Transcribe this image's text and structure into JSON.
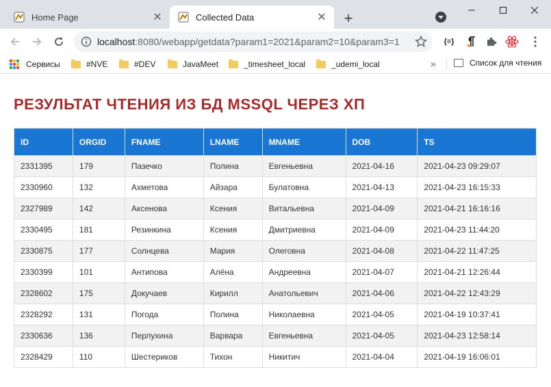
{
  "browser": {
    "tabs": [
      {
        "title": "Home Page",
        "active": false
      },
      {
        "title": "Collected Data",
        "active": true
      }
    ],
    "address": {
      "host": "localhost",
      "rest": ":8080/webapp/getdata?param1=2021&param2=10&param3=1"
    },
    "extensions": [
      "json-viewer-icon",
      "pilcrow-icon",
      "puzzle-icon",
      "react-icon"
    ],
    "bookmarks": {
      "apps_label": "Сервисы",
      "folders": [
        "#NVE",
        "#DEV",
        "JavaMeet",
        "_timesheet_local",
        "_udemi_local"
      ],
      "more": "»",
      "reading_list": "Список для чтения"
    }
  },
  "page": {
    "heading": "РЕЗУЛЬТАТ ЧТЕНИЯ ИЗ БД MSSQL ЧЕРЕЗ ХП",
    "columns": [
      "ID",
      "ORGID",
      "FNAME",
      "LNAME",
      "MNAME",
      "DOB",
      "TS"
    ],
    "rows": [
      [
        "2331395",
        "179",
        "Пазечко",
        "Полина",
        "Евгеньевна",
        "2021-04-16",
        "2021-04-23 09:29:07"
      ],
      [
        "2330960",
        "132",
        "Ахметова",
        "Айзара",
        "Булатовна",
        "2021-04-13",
        "2021-04-23 16:15:33"
      ],
      [
        "2327989",
        "142",
        "Аксенова",
        "Ксения",
        "Витальевна",
        "2021-04-09",
        "2021-04-21 16:16:16"
      ],
      [
        "2330495",
        "181",
        "Резинкина",
        "Ксения",
        "Дмитриевна",
        "2021-04-09",
        "2021-04-23 11:44:20"
      ],
      [
        "2330875",
        "177",
        "Солнцева",
        "Мария",
        "Олеговна",
        "2021-04-08",
        "2021-04-22 11:47:25"
      ],
      [
        "2330399",
        "101",
        "Антипова",
        "Алёна",
        "Андреевна",
        "2021-04-07",
        "2021-04-21 12:26:44"
      ],
      [
        "2328602",
        "175",
        "Докучаев",
        "Кирилл",
        "Анатольевич",
        "2021-04-06",
        "2021-04-22 12:43:29"
      ],
      [
        "2328292",
        "131",
        "Погода",
        "Полина",
        "Николаевна",
        "2021-04-05",
        "2021-04-19 10:37:41"
      ],
      [
        "2330636",
        "136",
        "Перлухина",
        "Варвара",
        "Евгеньевна",
        "2021-04-05",
        "2021-04-23 12:58:14"
      ],
      [
        "2328429",
        "110",
        "Шестериков",
        "Тихон",
        "Никитич",
        "2021-04-04",
        "2021-04-19 16:06:01"
      ]
    ]
  },
  "colors": {
    "heading": "#a52a2a",
    "table_header": "#1976d2",
    "row_alt": "#f2f2f2"
  }
}
